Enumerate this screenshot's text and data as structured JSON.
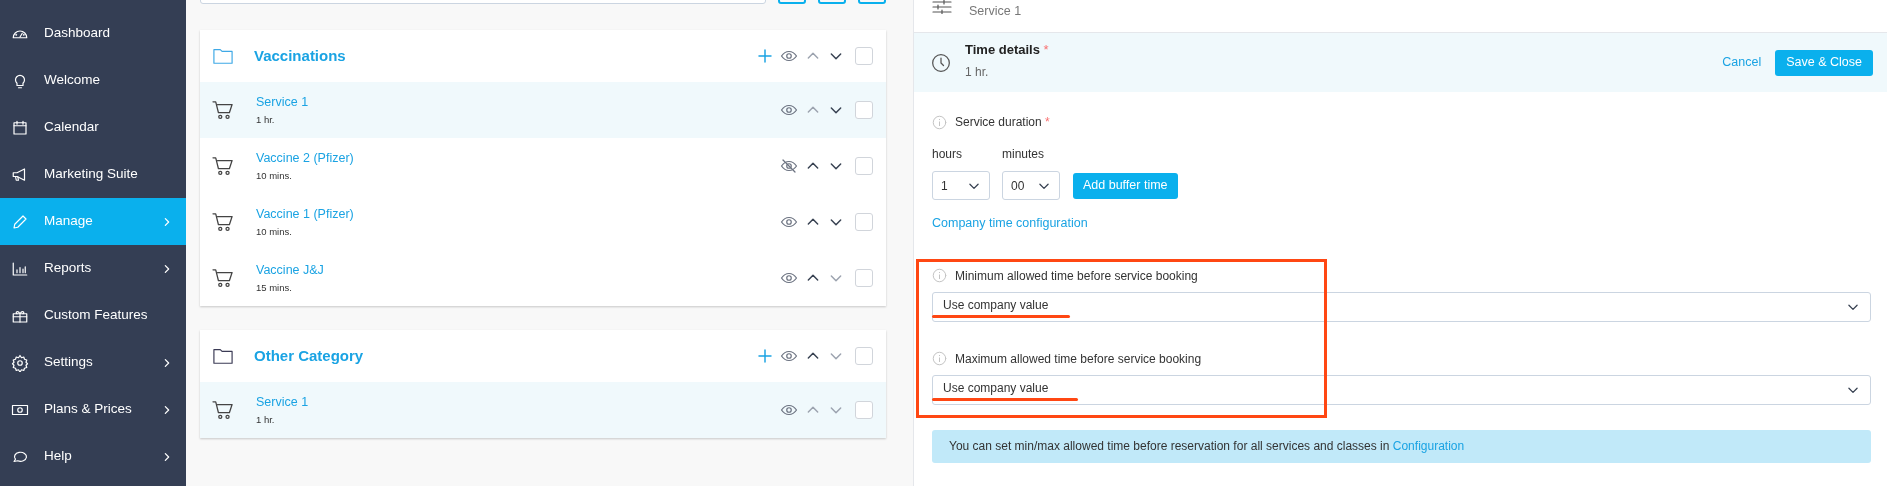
{
  "sidebar": {
    "items": [
      {
        "label": "Dashboard",
        "kind": "gauge",
        "selected": false,
        "has_submenu": false
      },
      {
        "label": "Welcome",
        "kind": "bulb",
        "selected": false,
        "has_submenu": false
      },
      {
        "label": "Calendar",
        "kind": "calendar",
        "selected": false,
        "has_submenu": false
      },
      {
        "label": "Marketing Suite",
        "kind": "megaphone",
        "selected": false,
        "has_submenu": false
      },
      {
        "label": "Manage",
        "kind": "pencil",
        "selected": true,
        "has_submenu": true
      },
      {
        "label": "Reports",
        "kind": "chart",
        "selected": false,
        "has_submenu": true
      },
      {
        "label": "Custom Features",
        "kind": "gift",
        "selected": false,
        "has_submenu": false
      },
      {
        "label": "Settings",
        "kind": "gear",
        "selected": false,
        "has_submenu": true
      },
      {
        "label": "Plans & Prices",
        "kind": "money",
        "selected": false,
        "has_submenu": true
      },
      {
        "label": "Help",
        "kind": "chat",
        "selected": false,
        "has_submenu": true
      }
    ]
  },
  "categories": [
    {
      "name": "Vaccinations",
      "visible": true,
      "up_disabled": true,
      "down_disabled": false,
      "checked": false,
      "services": [
        {
          "name": "Service 1",
          "duration": "1 hr.",
          "selected": true,
          "visible": true,
          "up_disabled": true,
          "down_disabled": false,
          "checked": false
        },
        {
          "name": "Vaccine 2 (Pfizer)",
          "duration": "10 mins.",
          "selected": false,
          "visible": false,
          "up_disabled": false,
          "down_disabled": false,
          "checked": false
        },
        {
          "name": "Vaccine 1 (Pfizer)",
          "duration": "10 mins.",
          "selected": false,
          "visible": true,
          "up_disabled": false,
          "down_disabled": false,
          "checked": false
        },
        {
          "name": "Vaccine J&J",
          "duration": "15 mins.",
          "selected": false,
          "visible": true,
          "up_disabled": false,
          "down_disabled": true,
          "checked": false
        }
      ]
    },
    {
      "name": "Other Category",
      "visible": true,
      "up_disabled": false,
      "down_disabled": true,
      "checked": false,
      "services": [
        {
          "name": "Service 1",
          "duration": "1 hr.",
          "selected": true,
          "visible": true,
          "up_disabled": true,
          "down_disabled": true,
          "checked": false
        }
      ]
    }
  ],
  "editor": {
    "top_section": {
      "subtitle": "Service 1"
    },
    "time_details": {
      "title": "Time details",
      "required_mark": "*",
      "summary": "1 hr.",
      "cancel": "Cancel",
      "save": "Save & Close"
    },
    "service_duration": {
      "label": "Service duration",
      "required_mark": "*",
      "hours_label": "hours",
      "minutes_label": "minutes",
      "hours_value": "1",
      "minutes_value": "00",
      "buffer_button": "Add buffer time",
      "config_link": "Company time configuration"
    },
    "min_time": {
      "label": "Minimum allowed time before service booking",
      "value": "Use company value"
    },
    "max_time": {
      "label": "Maximum allowed time before service booking",
      "value": "Use company value"
    },
    "notice": {
      "text": "You can set min/max allowed time before reservation for all services and classes in",
      "link": "Configuration"
    }
  }
}
